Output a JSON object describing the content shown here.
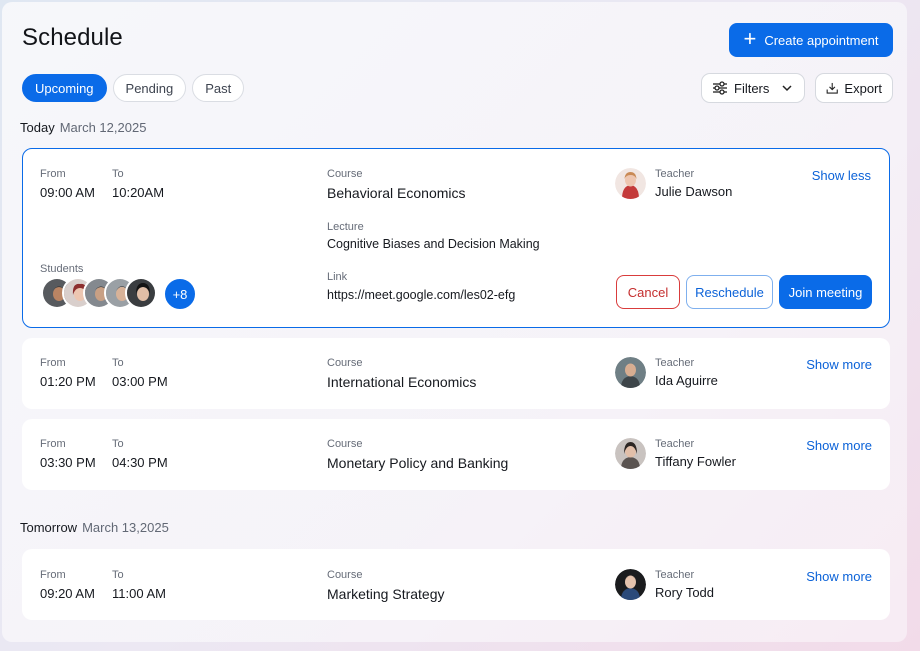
{
  "header": {
    "title": "Schedule",
    "create_label": "Create appointment"
  },
  "tabs": [
    {
      "label": "Upcoming",
      "active": true
    },
    {
      "label": "Pending",
      "active": false
    },
    {
      "label": "Past",
      "active": false
    }
  ],
  "toolbar": {
    "filters_label": "Filters",
    "export_label": "Export"
  },
  "days": [
    {
      "label": "Today",
      "date": "March 12,2025"
    },
    {
      "label": "Tomorrow",
      "date": "March 13,2025"
    }
  ],
  "labels": {
    "from": "From",
    "to": "To",
    "course": "Course",
    "teacher": "Teacher",
    "lecture": "Lecture",
    "link": "Link",
    "students": "Students"
  },
  "appointments": [
    {
      "from": "09:00 AM",
      "to": "10:20AM",
      "course": "Behavioral Economics",
      "teacher": "Julie Dawson",
      "lecture": "Cognitive Biases and Decision Making",
      "link": "https://meet.google.com/les02-efg",
      "students_more": "+8",
      "toggle_label": "Show less",
      "actions": {
        "cancel": "Cancel",
        "reschedule": "Reschedule",
        "join": "Join meeting"
      }
    },
    {
      "from": "01:20 PM",
      "to": "03:00 PM",
      "course": "International Economics",
      "teacher": "Ida Aguirre",
      "toggle_label": "Show more"
    },
    {
      "from": "03:30 PM",
      "to": "04:30 PM",
      "course": "Monetary Policy and Banking",
      "teacher": "Tiffany Fowler",
      "toggle_label": "Show more"
    },
    {
      "from": "09:20 AM",
      "to": "11:00 AM",
      "course": "Marketing Strategy",
      "teacher": "Rory Todd",
      "toggle_label": "Show more"
    }
  ],
  "colors": {
    "accent": "#0a6be8",
    "danger": "#d93c3c",
    "link": "#0b62d8"
  }
}
